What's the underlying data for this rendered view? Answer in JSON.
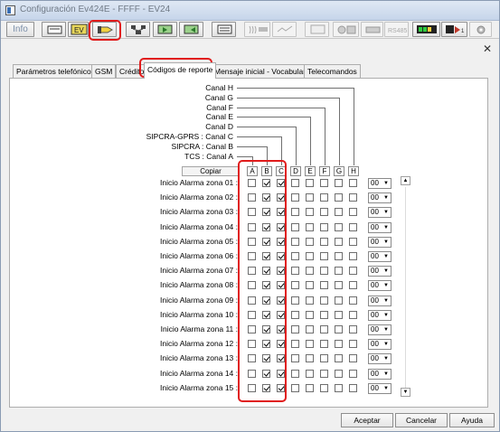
{
  "window": {
    "title": "Configuración Ev424E - FFFF - EV24"
  },
  "toolbar": {
    "info_label": "Info",
    "buttons": [
      "card-icon",
      "ev-icon",
      "key-pencil-icon",
      "network-icon",
      "upload-card-icon",
      "download-card-icon",
      "form-icon",
      "stream-icon",
      "chart-icon",
      "panel-icon",
      "keypad-icon",
      "printer-icon",
      "rs485-icon",
      "level-meter-icon",
      "arrow-device-icon",
      "gear-icon"
    ],
    "rs485_label": "RS485"
  },
  "tabs": [
    {
      "label": "Parámetros telefónicos"
    },
    {
      "label": "GSM"
    },
    {
      "label": "Crédito"
    },
    {
      "label": "Códigos de reporte"
    },
    {
      "label": "Mensaje inicial - Vocabulario"
    },
    {
      "label": "Telecomandos"
    }
  ],
  "channels": [
    "Canal H",
    "Canal G",
    "Canal F",
    "Canal E",
    "Canal D",
    "SIPCRA-GPRS : Canal C",
    "SIPCRA : Canal B",
    "TCS : Canal A"
  ],
  "copy_label": "Copiar",
  "column_headers": [
    "A",
    "B",
    "C",
    "D",
    "E",
    "F",
    "G",
    "H"
  ],
  "rows": [
    {
      "label": "Inicio Alarma zona 01 :",
      "checks": [
        false,
        true,
        true,
        false,
        false,
        false,
        false,
        false
      ],
      "value": "00"
    },
    {
      "label": "Inicio Alarma zona 02 :",
      "checks": [
        false,
        true,
        true,
        false,
        false,
        false,
        false,
        false
      ],
      "value": "00"
    },
    {
      "label": "Inicio Alarma zona 03 :",
      "checks": [
        false,
        true,
        true,
        false,
        false,
        false,
        false,
        false
      ],
      "value": "00"
    },
    {
      "label": "Inicio Alarma zona 04 :",
      "checks": [
        false,
        true,
        true,
        false,
        false,
        false,
        false,
        false
      ],
      "value": "00"
    },
    {
      "label": "Inicio Alarma zona 05 :",
      "checks": [
        false,
        true,
        true,
        false,
        false,
        false,
        false,
        false
      ],
      "value": "00"
    },
    {
      "label": "Inicio Alarma zona 06 :",
      "checks": [
        false,
        true,
        true,
        false,
        false,
        false,
        false,
        false
      ],
      "value": "00"
    },
    {
      "label": "Inicio Alarma zona 07 :",
      "checks": [
        false,
        true,
        true,
        false,
        false,
        false,
        false,
        false
      ],
      "value": "00"
    },
    {
      "label": "Inicio Alarma zona 08 :",
      "checks": [
        false,
        true,
        true,
        false,
        false,
        false,
        false,
        false
      ],
      "value": "00"
    },
    {
      "label": "Inicio Alarma zona 09 :",
      "checks": [
        false,
        true,
        true,
        false,
        false,
        false,
        false,
        false
      ],
      "value": "00"
    },
    {
      "label": "Inicio Alarma zona 10 :",
      "checks": [
        false,
        true,
        true,
        false,
        false,
        false,
        false,
        false
      ],
      "value": "00"
    },
    {
      "label": "Inicio Alarma zona 11 :",
      "checks": [
        false,
        true,
        true,
        false,
        false,
        false,
        false,
        false
      ],
      "value": "00"
    },
    {
      "label": "Inicio Alarma zona 12 :",
      "checks": [
        false,
        true,
        true,
        false,
        false,
        false,
        false,
        false
      ],
      "value": "00"
    },
    {
      "label": "Inicio Alarma zona 13 :",
      "checks": [
        false,
        true,
        true,
        false,
        false,
        false,
        false,
        false
      ],
      "value": "00"
    },
    {
      "label": "Inicio Alarma zona 14 :",
      "checks": [
        false,
        true,
        true,
        false,
        false,
        false,
        false,
        false
      ],
      "value": "00"
    },
    {
      "label": "Inicio Alarma zona 15 :",
      "checks": [
        false,
        true,
        true,
        false,
        false,
        false,
        false,
        false
      ],
      "value": "00"
    }
  ],
  "footer": {
    "accept": "Aceptar",
    "cancel": "Cancelar",
    "help": "Ayuda"
  },
  "colors": {
    "highlight": "#e01b1b",
    "titlebar": "#c6d5ea"
  }
}
